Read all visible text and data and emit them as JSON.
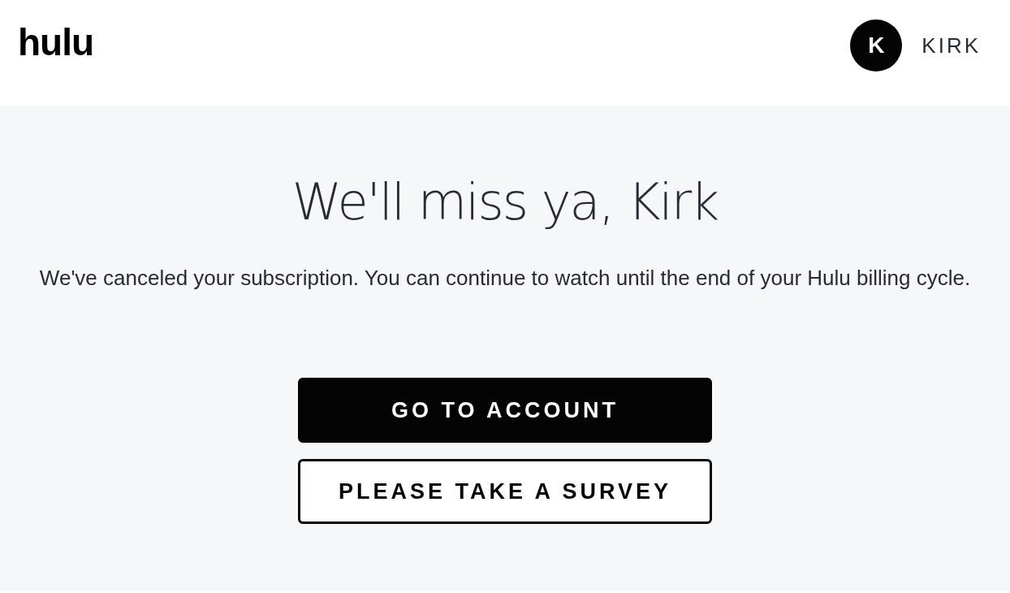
{
  "header": {
    "logo": "hulu",
    "avatar_initial": "K",
    "user_name": "KIRK"
  },
  "main": {
    "title": "We'll miss ya, Kirk",
    "message": "We've canceled your subscription. You can continue to watch until the end of your Hulu billing cycle.",
    "buttons": [
      {
        "label": "GO TO ACCOUNT",
        "kind": "primary"
      },
      {
        "label": "PLEASE TAKE A SURVEY",
        "kind": "secondary"
      }
    ]
  }
}
